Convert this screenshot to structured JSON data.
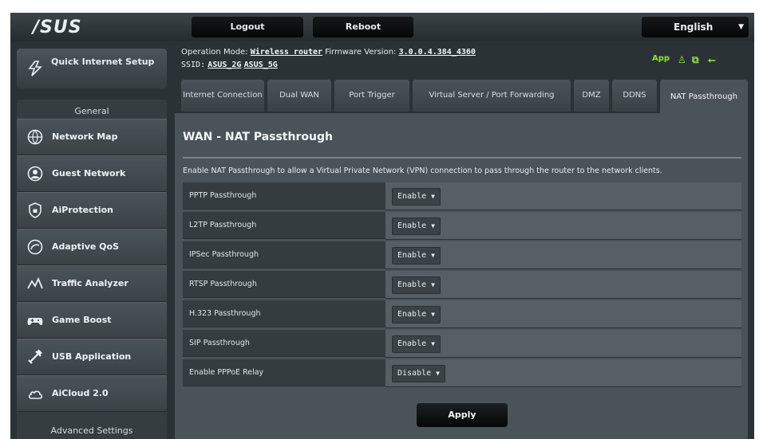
{
  "header": {
    "logo": "/SUS",
    "logout": "Logout",
    "reboot": "Reboot",
    "language": "English"
  },
  "menu": {
    "quick_setup": "Quick Internet Setup",
    "general_heading": "General",
    "items": [
      {
        "label": "Network Map",
        "icon": "network-map-icon"
      },
      {
        "label": "Guest Network",
        "icon": "guest-network-icon"
      },
      {
        "label": "AiProtection",
        "icon": "shield-icon"
      },
      {
        "label": "Adaptive QoS",
        "icon": "qos-gauge-icon"
      },
      {
        "label": "Traffic Analyzer",
        "icon": "traffic-analyzer-icon"
      },
      {
        "label": "Game Boost",
        "icon": "gamepad-icon"
      },
      {
        "label": "USB Application",
        "icon": "usb-icon"
      },
      {
        "label": "AiCloud 2.0",
        "icon": "cloud-icon"
      }
    ],
    "advanced_heading": "Advanced Settings"
  },
  "info": {
    "operation_mode_label": "Operation Mode:",
    "operation_mode_value": "Wireless router",
    "firmware_label": "Firmware Version:",
    "firmware_value": "3.0.0.4.384_4360",
    "ssid_label": "SSID:",
    "ssid_1": "ASUS_2G",
    "ssid_2": "ASUS_5G",
    "app_label": "App"
  },
  "tabs": [
    {
      "label": "Internet Connection",
      "active": false
    },
    {
      "label": "Dual WAN",
      "active": false
    },
    {
      "label": "Port Trigger",
      "active": false
    },
    {
      "label": "Virtual Server / Port Forwarding",
      "active": false
    },
    {
      "label": "DMZ",
      "active": false
    },
    {
      "label": "DDNS",
      "active": false
    },
    {
      "label": "NAT Passthrough",
      "active": true
    }
  ],
  "panel": {
    "title": "WAN - NAT Passthrough",
    "description": "Enable NAT Passthrough to allow a Virtual Private Network (VPN) connection to pass through the router to the network clients.",
    "rows": [
      {
        "label": "PPTP Passthrough",
        "value": "Enable"
      },
      {
        "label": "L2TP Passthrough",
        "value": "Enable"
      },
      {
        "label": "IPSec Passthrough",
        "value": "Enable"
      },
      {
        "label": "RTSP Passthrough",
        "value": "Enable"
      },
      {
        "label": "H.323 Passthrough",
        "value": "Enable"
      },
      {
        "label": "SIP Passthrough",
        "value": "Enable"
      },
      {
        "label": "Enable PPPoE Relay",
        "value": "Disable"
      }
    ],
    "apply": "Apply"
  },
  "colors": {
    "background": "#2a3236",
    "panel": "#4a5357",
    "status_green": "#8fe04a"
  }
}
